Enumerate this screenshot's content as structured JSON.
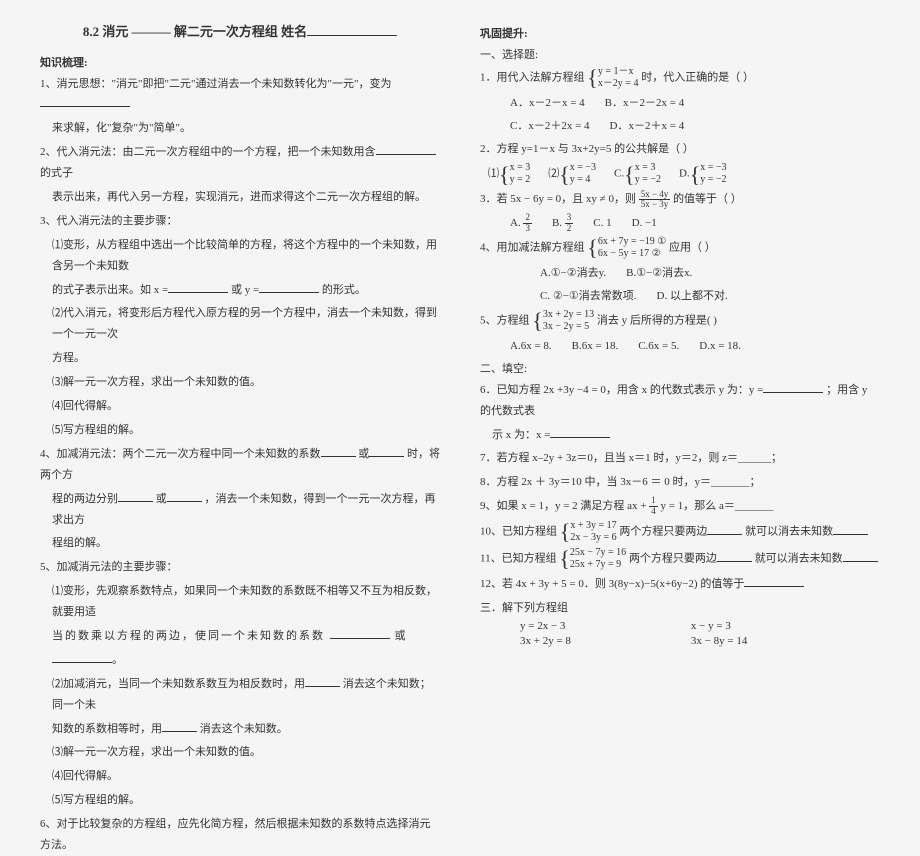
{
  "left": {
    "title": "8.2 消元 ——— 解二元一次方程组     姓名",
    "h1": "知识梳理:",
    "p1a": "1、消元思想：\"消元\"即把\"二元\"通过消去一个未知数转化为\"一元\"，变为",
    "p1b": "来求解，化\"复杂\"为\"简单\"。",
    "p2a": "2、代入消元法：由二元一次方程组中的一个方程，把一个未知数用含",
    "p2b": "的式子",
    "p2c": "表示出来，再代入另一方程，实现消元，进而求得这个二元一次方程组的解。",
    "p3": "3、代入消元法的主要步骤：",
    "p3_1a": "⑴变形，从方程组中选出一个比较简单的方程，将这个方程中的一个未知数，用含另一个未知数",
    "p3_1b": "的式子表示出来。如 x =",
    "p3_1c": "或 y =",
    "p3_1d": "的形式。",
    "p3_2": "⑵代入消元，将变形后方程代入原方程的另一个方程中，消去一个未知数，得到一个一元一次",
    "p3_2b": "方程。",
    "p3_3": "⑶解一元一次方程，求出一个未知数的值。",
    "p3_4": "⑷回代得解。",
    "p3_5": "⑸写方程组的解。",
    "p4a": "4、加减消元法：两个二元一次方程中同一个未知数的系数",
    "p4b": "或",
    "p4c": "时，将两个方",
    "p4d": "程的两边分别",
    "p4e": "或",
    "p4f": "，消去一个未知数，得到一个一元一次方程，再求出方",
    "p4g": "程组的解。",
    "p5": "5、加减消元法的主要步骤：",
    "p5_1a": "⑴变形，先观察系数特点，如果同一个未知数的系数既不相等又不互为相反数，就要用适",
    "p5_1b": "当的数乘以方程的两边，使同一个未知数的系数",
    "p5_1c": "   或",
    "p5_1d": "。",
    "p5_2a": "⑵加减消元，当同一个未知数系数互为相反数时，用",
    "p5_2b": "消去这个未知数；同一个未",
    "p5_2c": "知数的系数相等时，用",
    "p5_2d": "消去这个未知数。",
    "p5_3": "⑶解一元一次方程，求出一个未知数的值。",
    "p5_4": "⑷回代得解。",
    "p5_5": "⑸写方程组的解。",
    "p6": "6、对于比较复杂的方程组，应先化简方程，然后根据未知数的系数特点选择消元方法。"
  },
  "right": {
    "h1": "巩固提升:",
    "h_sel": "一、选择题:",
    "q1": "1．用代入法解方程组",
    "q1_eq1": "y = 1－x",
    "q1_eq2": "x－2y = 4",
    "q1_tail": "时，代入正确的是（   ）",
    "q1_a": "A．x－2－x = 4",
    "q1_b": "B．x－2－2x = 4",
    "q1_c": "C．x－2＋2x = 4",
    "q1_d": "D．x－2＋x = 4",
    "q2": "2．方程 y=1－x 与 3x+2y=5 的公共解是（   ）",
    "q2_1a": "x = 3",
    "q2_1b": "y = 2",
    "q2_2a": "x = −3",
    "q2_2b": "y = 4",
    "q2_3a": "x = 3",
    "q2_3b": "y = −2",
    "q2_4a": "x = −3",
    "q2_4b": "y = −2",
    "q3a": "3．若 5x − 6y = 0，且 xy ≠ 0，则",
    "q3_num": "5x − 4y",
    "q3_den": "5x − 3y",
    "q3b": "的值等于（   ）",
    "q3_a_num": "2",
    "q3_a_den": "3",
    "q3_b_num": "3",
    "q3_b_den": "2",
    "q3_opt_a": "A.",
    "q3_opt_b": "B.",
    "q3_opt_c": "C. 1",
    "q3_opt_d": "D. −1",
    "q4": "4、用加减法解方程组",
    "q4_eq1": "6x + 7y = −19  ①",
    "q4_eq2": "6x − 5y = 17   ②",
    "q4_tail": "  应用（   ）",
    "q4_a": "A.①−②消去y.",
    "q4_b": "B.①−②消去x.",
    "q4_c": "C. ②−①消去常数项.",
    "q4_d": "D. 以上都不对.",
    "q5": "5、方程组",
    "q5_eq1": "3x + 2y = 13",
    "q5_eq2": "3x − 2y = 5",
    "q5_tail": "消去 y 后所得的方程是(   )",
    "q5_a": "A.6x = 8.",
    "q5_b": "B.6x = 18.",
    "q5_c": "C.6x = 5.",
    "q5_d": "D.x = 18.",
    "h_fill": "二、填空:",
    "q6a": "6．已知方程 2x +3y −4 = 0，用含 x 的代数式表示 y 为：y =",
    "q6b": "；用含 y 的代数式表",
    "q6c": "示 x 为：x =",
    "q7": "7．若方程 x–2y + 3z＝0，且当 x＝1 时，y＝2，则 z＝______；",
    "q8": "8．方程 2x ＋ 3y＝10 中，当 3x－6 ＝ 0 时，y＝_______；",
    "q9a": "9、如果 x = 1，y = 2 满足方程 ax +",
    "q9_num": "1",
    "q9_den": "4",
    "q9b": "y = 1，那么 a＝_______",
    "q10": "10、已知方程组",
    "q10_eq1": "x + 3y = 17",
    "q10_eq2": "2x − 3y = 6",
    "q10_tail": "两个方程只要两边",
    "q10_end": "就可以消去未知数",
    "q11": "11、已知方程组",
    "q11_eq1": "25x − 7y = 16",
    "q11_eq2": "25x + 7y = 9",
    "q11_tail": "两个方程只要两边",
    "q11_end": "就可以消去未知数",
    "q12": "12、若 4x + 3y + 5 = 0．则 3(8y−x)−5(x+6y−2) 的值等于",
    "h_solve": "三．解下列方程组",
    "s1a": "y = 2x − 3",
    "s1b": "3x + 2y = 8",
    "s2a": "x − y = 3",
    "s2b": "3x − 8y = 14"
  }
}
